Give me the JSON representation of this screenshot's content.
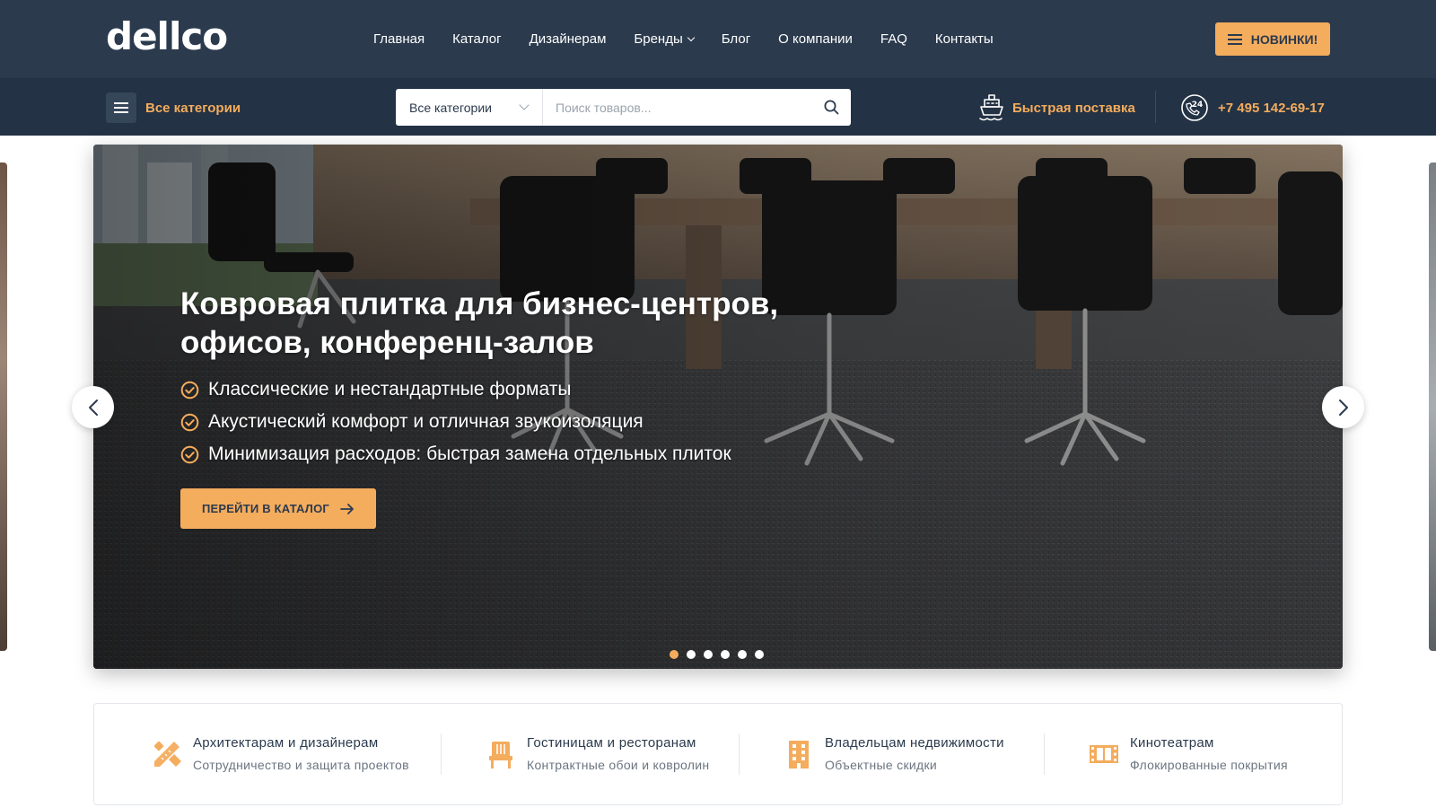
{
  "header": {
    "logo_text": "dellco",
    "nav": [
      {
        "label": "Главная"
      },
      {
        "label": "Каталог"
      },
      {
        "label": "Дизайнерам"
      },
      {
        "label": "Бренды",
        "has_dropdown": true
      },
      {
        "label": "Блог"
      },
      {
        "label": "О компании"
      },
      {
        "label": "FAQ"
      },
      {
        "label": "Контакты"
      }
    ],
    "new_button": "НОВИНКИ!"
  },
  "subheader": {
    "categories_button": "Все категории",
    "search": {
      "category_value": "Все категории",
      "placeholder": "Поиск товаров..."
    },
    "delivery_label": "Быстрая поставка",
    "phone_badge": "24",
    "phone": "+7 495 142-69-17"
  },
  "hero": {
    "title": "Ковровая плитка для бизнес-центров, офисов, конференц-залов",
    "bullets": [
      "Классические и нестандартные форматы",
      "Акустический комфорт и отличная звукоизоляция",
      "Минимизация расходов: быстрая замена отдельных плиток"
    ],
    "cta_label": "ПЕРЕЙТИ В КАТАЛОГ",
    "slide_count": 6,
    "active_slide": 1
  },
  "features": [
    {
      "icon": "ruler-pencil-icon",
      "title": "Архитектарам и дизайнерам",
      "subtitle": "Сотрудничество и защита проектов"
    },
    {
      "icon": "chair-icon",
      "title": "Гостиницам и ресторанам",
      "subtitle": "Контрактные обои и ковролин"
    },
    {
      "icon": "building-icon",
      "title": "Владельцам недвижимости",
      "subtitle": "Объектные скидки"
    },
    {
      "icon": "film-icon",
      "title": "Кинотеатрам",
      "subtitle": "Флокированные покрытия"
    }
  ],
  "colors": {
    "header_bg": "#2b3a4d",
    "subheader_bg": "#233244",
    "accent": "#f4ac5d",
    "text_dark": "#2b3a4d"
  }
}
